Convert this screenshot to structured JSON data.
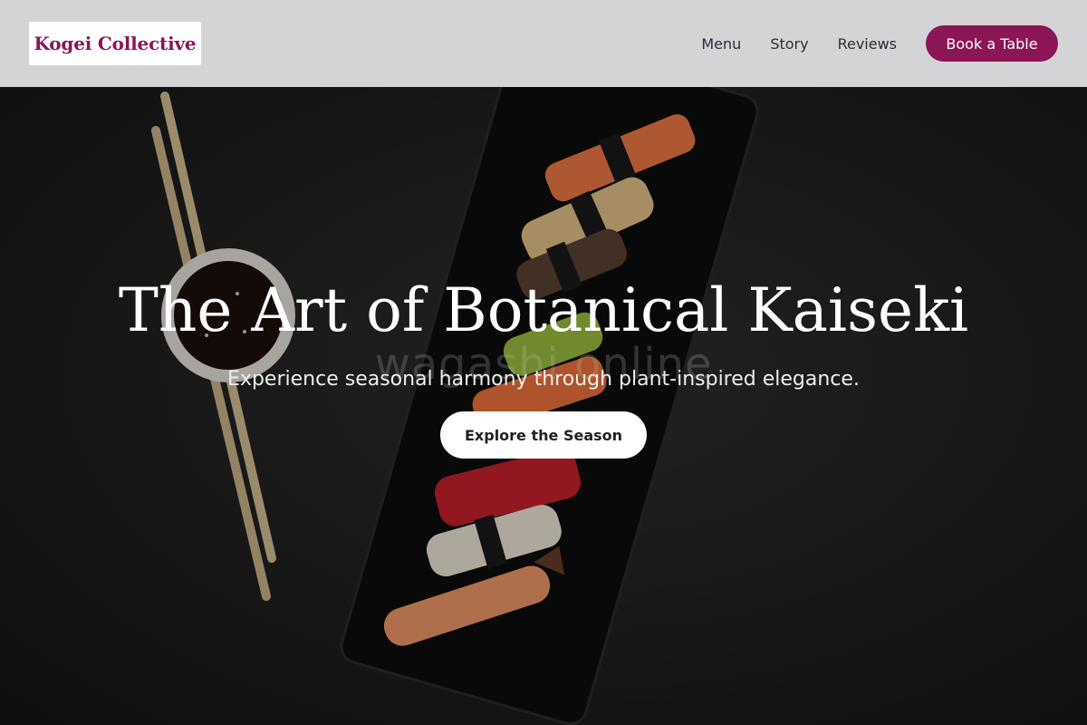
{
  "brand": {
    "name": "Kogei Collective",
    "color": "#8b1556"
  },
  "nav": {
    "links": [
      "Menu",
      "Story",
      "Reviews"
    ],
    "cta": "Book a Table"
  },
  "hero": {
    "title": "The Art of Botanical Kaiseki",
    "subtitle": "Experience seasonal harmony through plant-inspired elegance.",
    "cta": "Explore the Season",
    "watermark": "wagashi online",
    "image": "sushi-plate-with-chopsticks-and-soy-sauce"
  }
}
